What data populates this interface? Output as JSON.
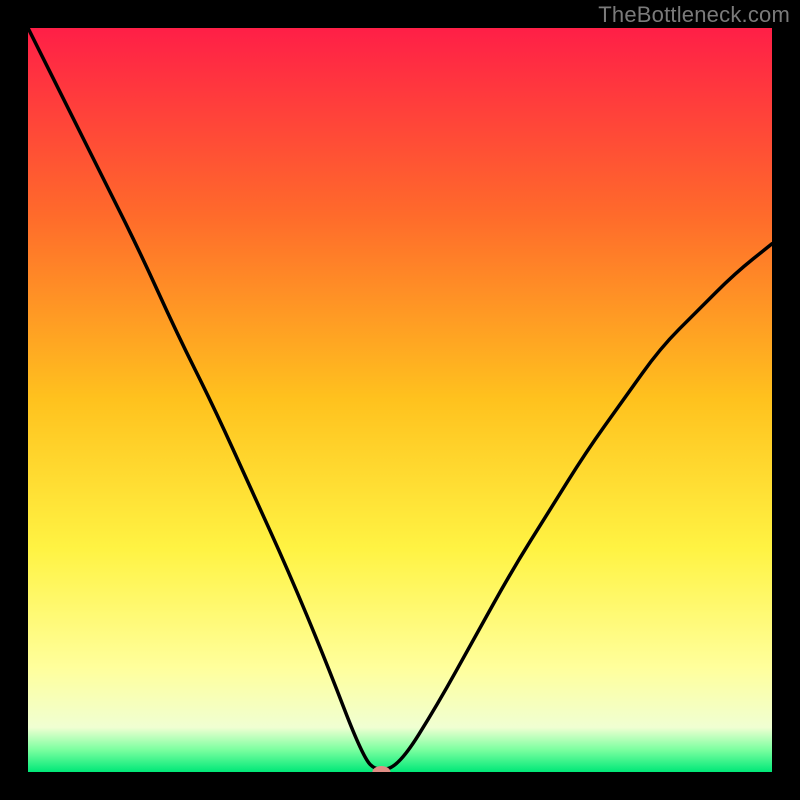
{
  "watermark": "TheBottleneck.com",
  "chart_data": {
    "type": "line",
    "title": "",
    "xlabel": "",
    "ylabel": "",
    "xlim": [
      0,
      100
    ],
    "ylim": [
      0,
      100
    ],
    "x": [
      0,
      5,
      10,
      15,
      20,
      25,
      30,
      35,
      40,
      45,
      47,
      50,
      55,
      60,
      65,
      70,
      75,
      80,
      85,
      90,
      95,
      100
    ],
    "values": [
      100,
      90,
      80,
      70,
      59,
      49,
      38,
      27,
      15,
      2,
      0,
      1,
      9,
      18,
      27,
      35,
      43,
      50,
      57,
      62,
      67,
      71
    ],
    "marker": {
      "x": 47.5,
      "y": 0
    },
    "gradient_bands": [
      {
        "start": 0,
        "color": "#ff1f47"
      },
      {
        "start": 25,
        "color": "#ff6a2b"
      },
      {
        "start": 50,
        "color": "#ffc21e"
      },
      {
        "start": 70,
        "color": "#fff343"
      },
      {
        "start": 86,
        "color": "#ffff9c"
      },
      {
        "start": 94,
        "color": "#f0ffd2"
      },
      {
        "start": 97,
        "color": "#7cffa0"
      },
      {
        "start": 100,
        "color": "#00e878"
      }
    ]
  }
}
